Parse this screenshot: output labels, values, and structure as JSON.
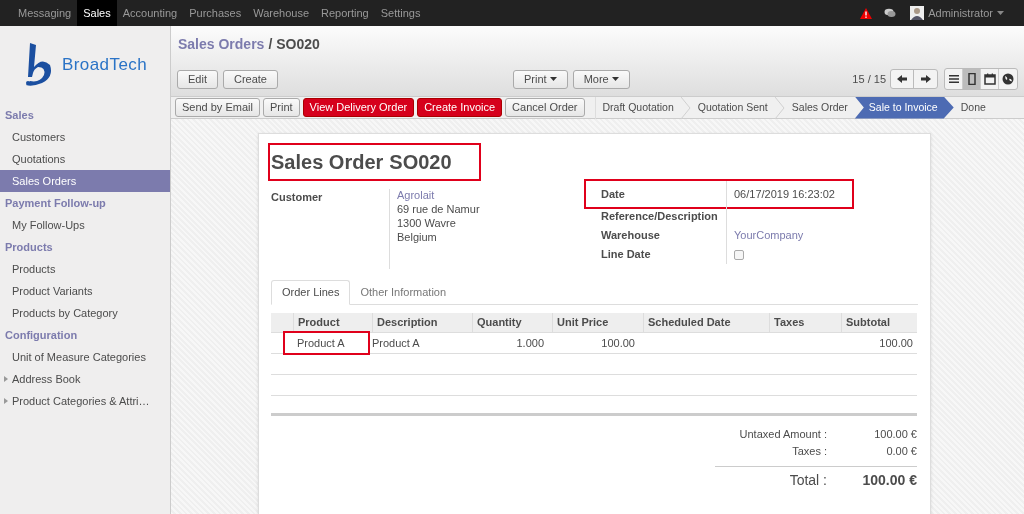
{
  "top_menu": [
    {
      "label": "Messaging",
      "selected": false
    },
    {
      "label": "Sales",
      "selected": true
    },
    {
      "label": "Accounting",
      "selected": false
    },
    {
      "label": "Purchases",
      "selected": false
    },
    {
      "label": "Warehouse",
      "selected": false
    },
    {
      "label": "Reporting",
      "selected": false
    },
    {
      "label": "Settings",
      "selected": false
    }
  ],
  "user": {
    "name": "Administrator"
  },
  "logo": {
    "text": "BroadTech"
  },
  "sidebar": [
    {
      "heading": "Sales",
      "items": [
        {
          "label": "Customers",
          "kind": "link",
          "selected": false
        },
        {
          "label": "Quotations",
          "kind": "link",
          "selected": false
        },
        {
          "label": "Sales Orders",
          "kind": "link",
          "selected": true
        }
      ]
    },
    {
      "heading": "Payment Follow-up",
      "items": [
        {
          "label": "My Follow-Ups",
          "kind": "link",
          "selected": false
        }
      ]
    },
    {
      "heading": "Products",
      "items": [
        {
          "label": "Products",
          "kind": "link",
          "selected": false
        },
        {
          "label": "Product Variants",
          "kind": "link",
          "selected": false
        },
        {
          "label": "Products by Category",
          "kind": "link",
          "selected": false
        }
      ]
    },
    {
      "heading": "Configuration",
      "items": [
        {
          "label": "Unit of Measure Categories",
          "kind": "link",
          "selected": false
        },
        {
          "label": "Address Book",
          "kind": "group",
          "selected": false
        },
        {
          "label": "Product Categories & Attri…",
          "kind": "group",
          "selected": false
        }
      ]
    }
  ],
  "breadcrumb": {
    "parent": "Sales Orders",
    "separator": "/",
    "current": "SO020"
  },
  "toolbar": {
    "left": [
      "Edit",
      "Create"
    ],
    "menus": [
      "Print",
      "More"
    ],
    "pager": "15 / 15",
    "views": [
      {
        "kind": "list",
        "selected": false
      },
      {
        "kind": "form",
        "selected": true
      },
      {
        "kind": "calendar",
        "selected": false
      },
      {
        "kind": "map",
        "selected": false
      }
    ]
  },
  "actions": [
    {
      "label": "Send by Email",
      "kind": "default"
    },
    {
      "label": "Print",
      "kind": "default"
    },
    {
      "label": "View Delivery Order",
      "kind": "primary"
    },
    {
      "label": "Create Invoice",
      "kind": "primary"
    },
    {
      "label": "Cancel Order",
      "kind": "default"
    }
  ],
  "stages": [
    {
      "label": "Draft Quotation",
      "selected": false
    },
    {
      "label": "Quotation Sent",
      "selected": false
    },
    {
      "label": "Sales Order",
      "selected": false
    },
    {
      "label": "Sale to Invoice",
      "selected": true
    },
    {
      "label": "Done",
      "selected": false
    }
  ],
  "sheet": {
    "title": {
      "prefix": "Sales Order",
      "number": "SO020",
      "highlighted": true
    },
    "customer": {
      "label": "Customer",
      "name": "Agrolait",
      "address": [
        "69 rue de Namur",
        "1300 Wavre",
        "Belgium"
      ]
    },
    "fields": [
      {
        "label": "Date",
        "value": "06/17/2019 16:23:02",
        "kind": "text",
        "highlighted": true
      },
      {
        "label": "Reference/Description",
        "kind": "text",
        "highlighted": false
      },
      {
        "label": "Warehouse",
        "value": "YourCompany",
        "kind": "link",
        "highlighted": false
      },
      {
        "label": "Line Date",
        "kind": "checkbox",
        "checked": false,
        "highlighted": false
      }
    ],
    "tabs": [
      {
        "label": "Order Lines",
        "selected": true
      },
      {
        "label": "Other Information",
        "selected": false
      }
    ],
    "table": {
      "columns": [
        "Product",
        "Description",
        "Quantity",
        "Unit Price",
        "Scheduled Date",
        "Taxes",
        "Subtotal"
      ],
      "rows": [
        {
          "cells": [
            "Product A",
            "Product A",
            "1.000",
            "100.00",
            "",
            "",
            "100.00"
          ],
          "highlighted": true
        }
      ]
    },
    "totals": [
      {
        "label": "Untaxed Amount :",
        "value": "100.00 €"
      },
      {
        "label": "Taxes :",
        "value": "0.00 €"
      }
    ],
    "grand_total": {
      "label": "Total :",
      "value": "100.00 €"
    }
  }
}
